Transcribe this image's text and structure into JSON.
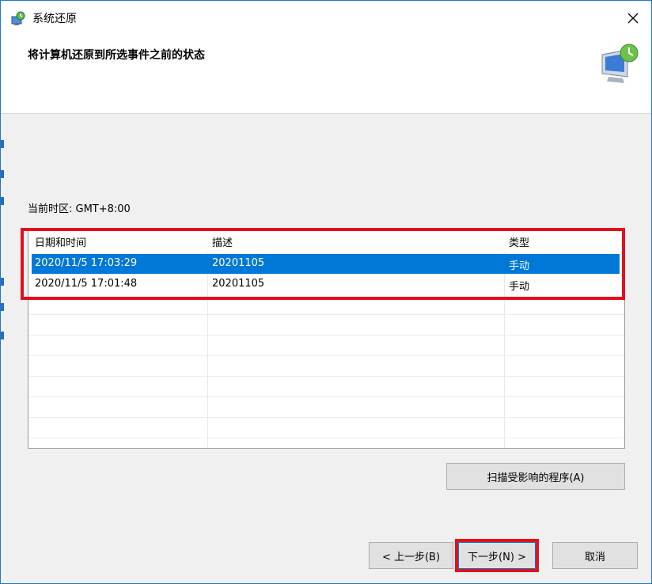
{
  "window": {
    "title": "系统还原",
    "close_glyph": "✕"
  },
  "header": {
    "title": "将计算机还原到所选事件之前的状态",
    "graphic_icon": "system-restore-icon"
  },
  "timezone_label": "当前时区: GMT+8:00",
  "table": {
    "columns": [
      "日期和时间",
      "描述",
      "类型"
    ],
    "rows": [
      {
        "datetime": "2020/11/5 17:03:29",
        "description": "20201105",
        "type": "手动",
        "selected": true
      },
      {
        "datetime": "2020/11/5 17:01:48",
        "description": "20201105",
        "type": "手动",
        "selected": false
      }
    ]
  },
  "buttons": {
    "scan": "扫描受影响的程序(A)",
    "back": "< 上一步(B)",
    "next": "下一步(N) >",
    "cancel": "取消"
  },
  "colors": {
    "selection": "#0078d7",
    "highlight": "#e3101c"
  }
}
